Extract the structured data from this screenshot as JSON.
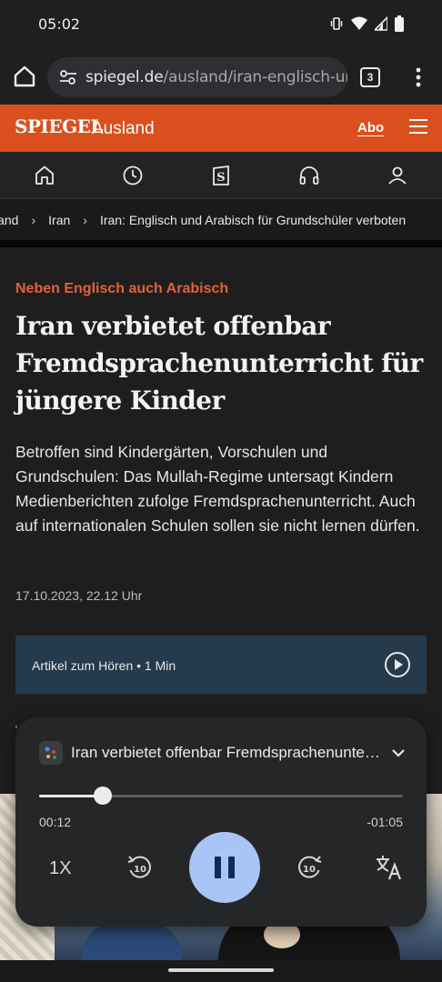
{
  "status_bar": {
    "time": "05:02",
    "icons": [
      "vibrate-icon",
      "wifi-icon",
      "signal-icon",
      "battery-icon"
    ]
  },
  "browser": {
    "url_host": "spiegel.de",
    "url_path": "/ausland/iran-englisch-und",
    "tab_count": "3"
  },
  "site_header": {
    "logo": "SPIEGEL",
    "section": "Ausland",
    "abo_label": "Abo",
    "accent_color": "#d9501e"
  },
  "nav": {
    "icons": [
      "home-icon",
      "clock-icon",
      "spiegel-plus-icon",
      "headphones-icon",
      "account-icon"
    ]
  },
  "breadcrumb": {
    "items": [
      "Ausland",
      "Iran",
      "Iran: Englisch und Arabisch für Grundschüler verboten"
    ],
    "first_visible": "land"
  },
  "article": {
    "kicker": "Neben Englisch auch Arabisch",
    "headline": "Iran verbietet offenbar Fremdsprachenunterricht für jüngere Kinder",
    "lead": "Betroffen sind Kindergärten, Vorschulen und Grundschulen: Das Mullah-Regime untersagt Kindern Medienberichten zufolge Fremdsprachenunterricht. Auch auf internationalen Schulen sollen sie nicht lernen dürfen.",
    "date": "17.10.2023, 22.12 Uhr",
    "audio_label": "Artikel zum Hören  •  1 Min"
  },
  "player": {
    "title": "Iran verbietet offenbar Fremdsprachenunterricht für jüngere Kinder",
    "elapsed": "00:12",
    "remaining": "-01:05",
    "progress_fraction": 0.175,
    "speed": "1X",
    "skip_seconds": "10",
    "pause_color": "#a9c5f5"
  }
}
